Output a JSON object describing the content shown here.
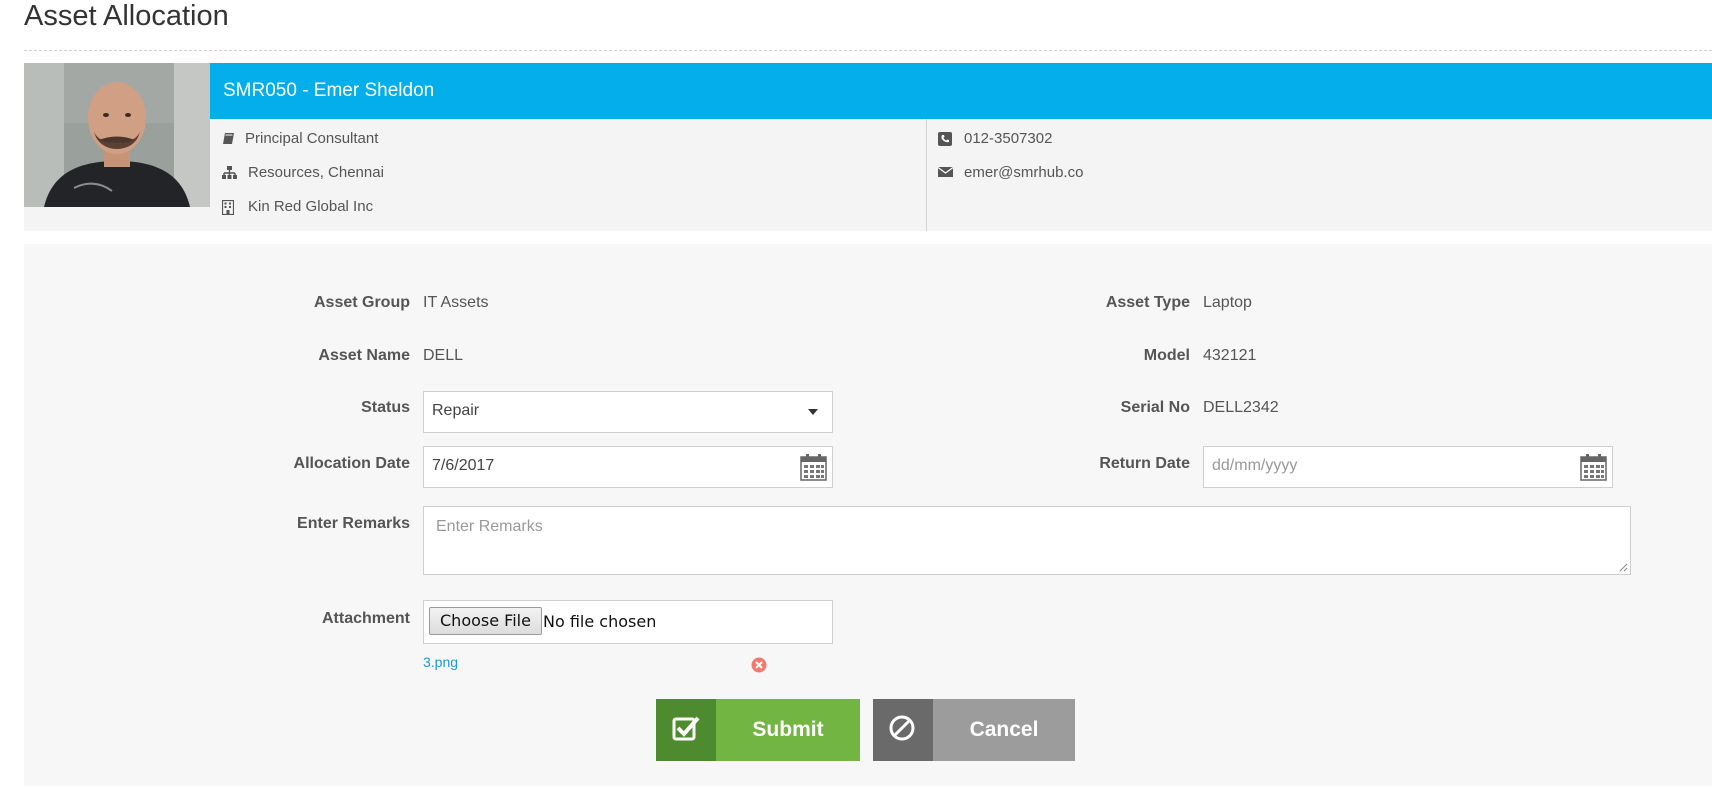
{
  "page": {
    "title": "Asset Allocation"
  },
  "profile": {
    "header": "SMR050 - Emer Sheldon",
    "designation": "Principal Consultant",
    "department": "Resources, Chennai",
    "company": "Kin Red Global Inc",
    "phone": "012-3507302",
    "email": "emer@smrhub.co",
    "icons": {
      "designation": "book-icon",
      "department": "org-chart-icon",
      "company": "building-icon",
      "phone": "phone-icon",
      "email": "envelope-icon"
    },
    "header_color": "#03aeea"
  },
  "form": {
    "asset_group": {
      "label": "Asset Group",
      "value": "IT Assets"
    },
    "asset_type": {
      "label": "Asset Type",
      "value": "Laptop"
    },
    "asset_name": {
      "label": "Asset Name",
      "value": "DELL"
    },
    "model": {
      "label": "Model",
      "value": "432121"
    },
    "status": {
      "label": "Status",
      "value": "Repair"
    },
    "serial_no": {
      "label": "Serial No",
      "value": "DELL2342"
    },
    "allocation_date": {
      "label": "Allocation Date",
      "value": "7/6/2017"
    },
    "return_date": {
      "label": "Return Date",
      "value": "",
      "placeholder": "dd/mm/yyyy"
    },
    "remarks": {
      "label": "Enter Remarks",
      "value": "",
      "placeholder": "Enter Remarks"
    },
    "attachment": {
      "label": "Attachment",
      "button_label": "Choose File",
      "status_text": "No file chosen",
      "existing_file": "3.png"
    }
  },
  "actions": {
    "submit_label": "Submit",
    "cancel_label": "Cancel",
    "submit_color": "#72b542",
    "cancel_color": "#9c9c9c"
  }
}
